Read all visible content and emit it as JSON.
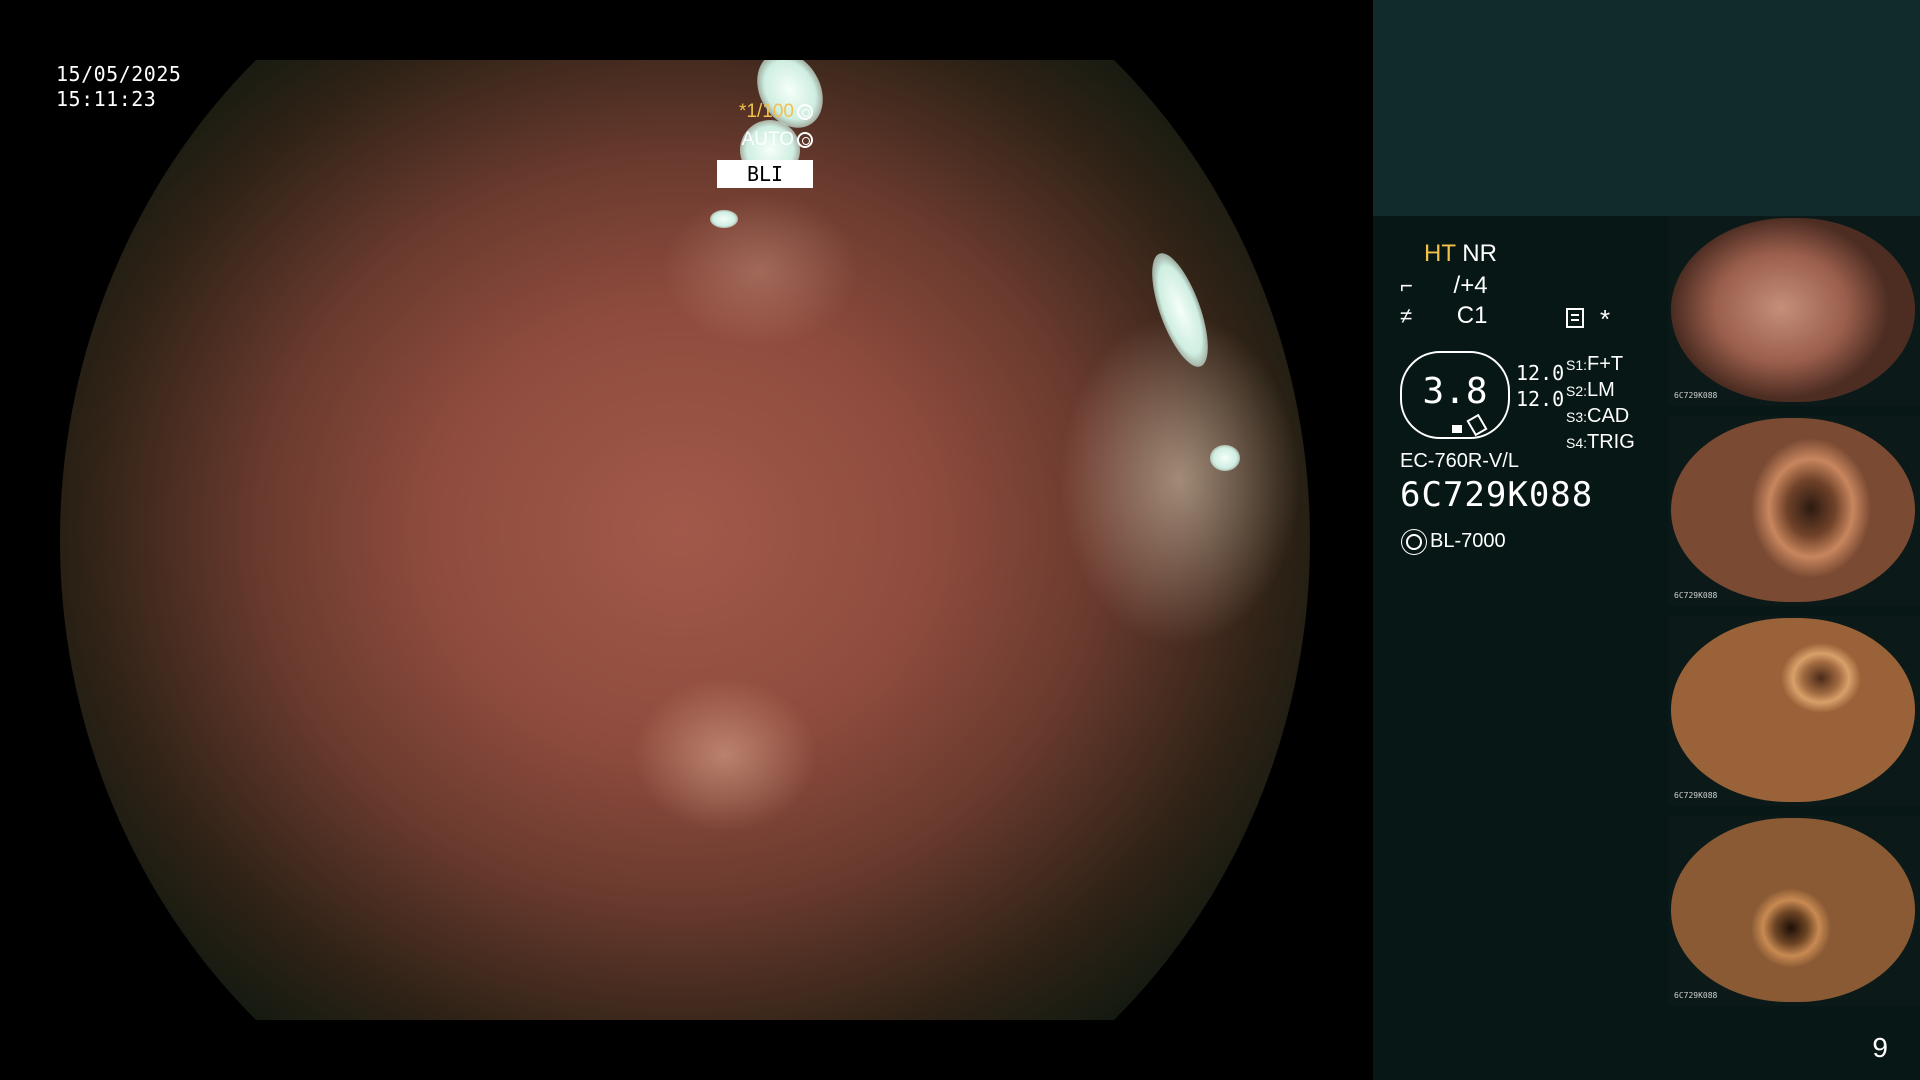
{
  "overlay": {
    "date": "15/05/2025",
    "time": "15:11:23",
    "shutter_speed": "*1/100",
    "iris_mode": "AUTO",
    "mode_badge": "BLI"
  },
  "settings": {
    "ht": "HT",
    "nr": "NR",
    "enhancement": "/+4",
    "color": "C1",
    "star": "*",
    "zoom_value": "3.8",
    "param1": "12.0",
    "param2": "12.0",
    "switches": [
      {
        "key": "S1:",
        "value": "F+T"
      },
      {
        "key": "S2:",
        "value": "LM"
      },
      {
        "key": "S3:",
        "value": "CAD"
      },
      {
        "key": "S4:",
        "value": "TRIG"
      }
    ],
    "scope_model": "EC-760R-V/L",
    "scope_serial": "6C729K088",
    "light_source": "BL-7000"
  },
  "thumbnails": [
    {
      "label": "6C729K088"
    },
    {
      "label": "6C729K088"
    },
    {
      "label": "6C729K088"
    },
    {
      "label": "6C729K088"
    }
  ],
  "page_number": "9",
  "icons": [
    "aperture-icon",
    "iris-icon",
    "enhancement-icon",
    "color-mode-icon",
    "menu-icon",
    "light-source-icon"
  ]
}
